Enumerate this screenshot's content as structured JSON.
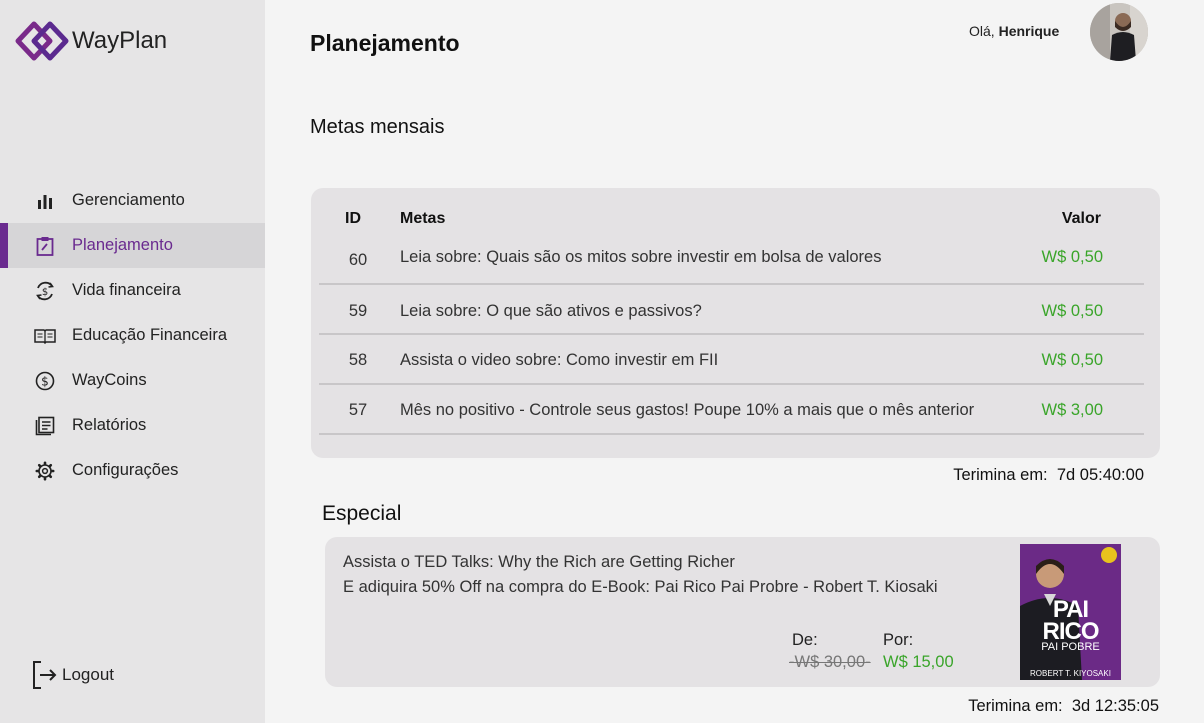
{
  "brand": {
    "name": "WayPlan",
    "accent": "#6a2a8f"
  },
  "nav": [
    {
      "label": "Gerenciamento",
      "icon": "bar-chart-icon"
    },
    {
      "label": "Planejamento",
      "icon": "clipboard-icon",
      "active": true
    },
    {
      "label": "Vida financeira",
      "icon": "refresh-dollar-icon"
    },
    {
      "label": "Educação Financeira",
      "icon": "book-icon"
    },
    {
      "label": "WayCoins",
      "icon": "coin-icon"
    },
    {
      "label": "Relatórios",
      "icon": "report-icon"
    },
    {
      "label": "Configurações",
      "icon": "gear-icon"
    }
  ],
  "logout": {
    "label": "Logout",
    "icon": "logout-icon"
  },
  "header": {
    "title": "Planejamento",
    "greeting": "Olá,",
    "user_name": "Henrique"
  },
  "monthly": {
    "title": "Metas mensais",
    "columns": {
      "id": "ID",
      "goal": "Metas",
      "value": "Valor"
    },
    "rows": [
      {
        "id": "60",
        "text": "Leia sobre: Quais são os mitos sobre investir em bolsa de valores",
        "value": "W$ 0,50"
      },
      {
        "id": "59",
        "text": "Leia sobre: O que são ativos e passivos?",
        "value": "W$ 0,50"
      },
      {
        "id": "58",
        "text": "Assista o video sobre: Como investir em FII",
        "value": "W$ 0,50"
      },
      {
        "id": "57",
        "text": "Mês no positivo - Controle seus gastos! Poupe 10% a mais que o mês anterior",
        "value": "W$ 3,00"
      }
    ],
    "ends_label": "Terimina em:",
    "ends_value": "7d 05:40:00"
  },
  "special": {
    "title": "Especial",
    "line1": "Assista o TED Talks: Why the Rich are Getting Richer",
    "line2": "E adiquira 50% Off na compra do E-Book: Pai Rico Pai Probre - Robert T. Kiosaki",
    "from_label": "De:",
    "from_price": "-W$ 30,00-",
    "to_label": "Por:",
    "to_price": "W$ 15,00",
    "ends_label": "Terimina em:",
    "ends_value": "3d 12:35:05",
    "book": {
      "title_line1": "PAI",
      "title_line2": "RICO",
      "subtitle": "PAI POBRE",
      "author": "ROBERT T. KIYOSAKI"
    }
  },
  "colors": {
    "positive": "#3aa52a",
    "sidebar_bg": "#e6e5e6",
    "card_bg": "#e4e2e4"
  }
}
